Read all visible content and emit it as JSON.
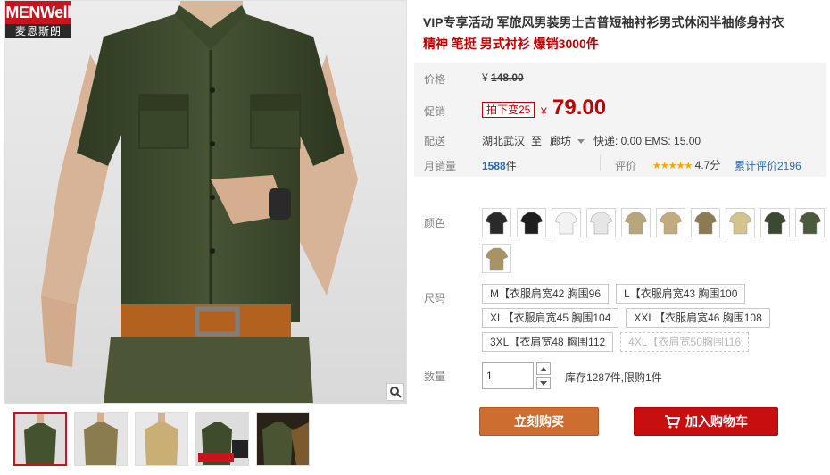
{
  "brand": {
    "name": "MENWell",
    "subname": "麦恩斯朗"
  },
  "product": {
    "title": "VIP专享活动 军旅风男装男士吉普短袖衬衫男式休闲半袖修身衬衣",
    "subtitle": "精神 笔挺 男式衬衫 爆销3000件"
  },
  "price": {
    "label": "价格",
    "currency": "¥",
    "original": "148.00",
    "promo_label": "促销",
    "promo_tag": "拍下变25",
    "promo_price": "79.00"
  },
  "shipping": {
    "label": "配送",
    "from": "湖北武汉",
    "to_word": "至",
    "to": "廊坊",
    "fee": "快递: 0.00 EMS: 15.00"
  },
  "sales": {
    "label": "月销量",
    "count": "1588",
    "unit": "件",
    "rating_label": "评价",
    "rating_stars": "★★★★★",
    "rating_score": "4.7分",
    "review_count": "累计评价2196"
  },
  "colors": {
    "label": "颜色",
    "swatches": [
      "#2a2a2a",
      "#1e1e1e",
      "#f2f2f2",
      "#e6e6e6",
      "#b9a57a",
      "#c2ab7c",
      "#8c7b50",
      "#d3c48f",
      "#3a4a30",
      "#4b5a3c",
      "#a89462"
    ]
  },
  "sizes": {
    "label": "尺码",
    "options": [
      [
        "M【衣服肩宽42 胸围96",
        "L【衣服肩宽43 胸围100"
      ],
      [
        "XL【衣服肩宽45 胸围104",
        "XXL【衣服肩宽46 胸围108"
      ],
      [
        "3XL【衣肩宽48 胸围112",
        "4XL【衣肩宽50胸围116"
      ]
    ]
  },
  "quantity": {
    "label": "数量",
    "value": "1",
    "stock": "库存1287件,限购1件"
  },
  "actions": {
    "buy_now": "立刻购买",
    "add_to_cart": "加入购物车"
  },
  "thumbnails": [
    "#44522f",
    "#8a7c4f",
    "#c9ae76",
    "#3f4c2c",
    "#4b5432"
  ]
}
